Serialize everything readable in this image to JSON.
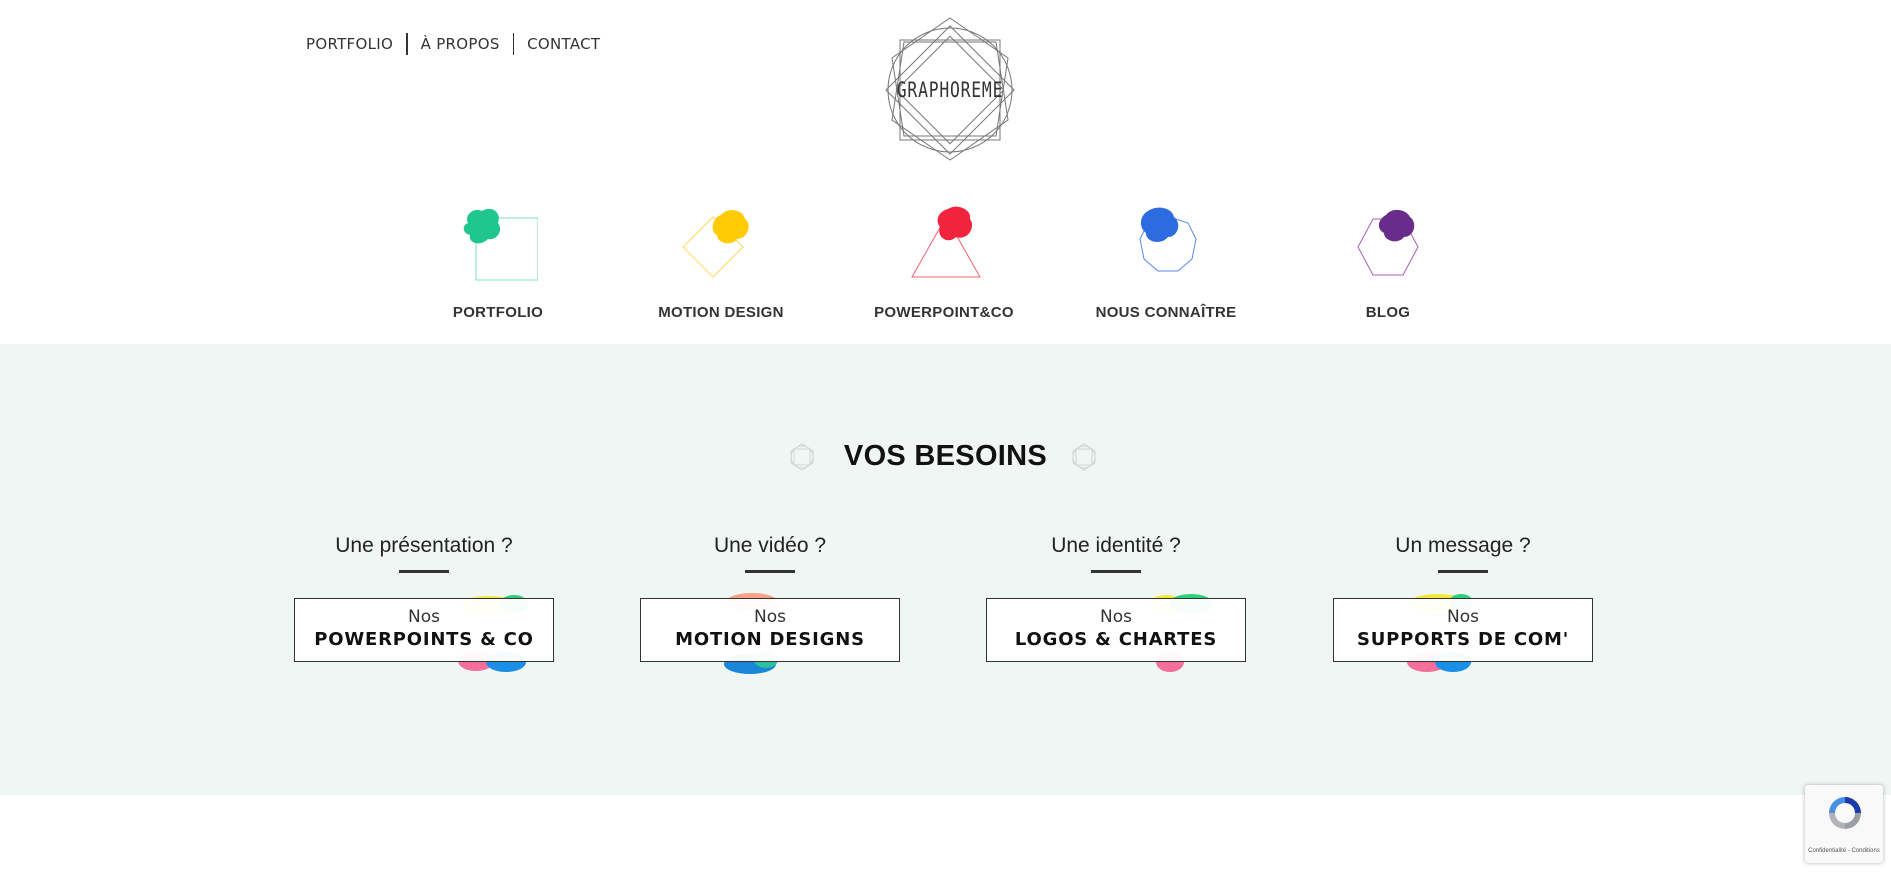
{
  "header": {
    "nav": [
      "PORTFOLIO",
      "À PROPOS",
      "CONTACT"
    ],
    "logo_text": "GRAPHOREME"
  },
  "categories": [
    {
      "label": "PORTFOLIO",
      "icon": "square-green-splash-icon",
      "color": "#1fc78f"
    },
    {
      "label": "MOTION DESIGN",
      "icon": "diamond-yellow-splash-icon",
      "color": "#ffcb05"
    },
    {
      "label": "POWERPOINT&CO",
      "icon": "triangle-red-splash-icon",
      "color": "#f0243c"
    },
    {
      "label": "NOUS CONNAÎTRE",
      "icon": "circle-blue-splash-icon",
      "color": "#2d6be0"
    },
    {
      "label": "BLOG",
      "icon": "hexagon-purple-splash-icon",
      "color": "#6a2c8a"
    }
  ],
  "needs": {
    "title": "VOS BESOINS",
    "items": [
      {
        "question": "Une présentation ?",
        "small": "Nos",
        "big": "POWERPOINTS & CO"
      },
      {
        "question": "Une vidéo ?",
        "small": "Nos",
        "big": "MOTION DESIGNS"
      },
      {
        "question": "Une identité ?",
        "small": "Nos",
        "big": "LOGOS & CHARTES"
      },
      {
        "question": "Un message ?",
        "small": "Nos",
        "big": "SUPPORTS DE COM'"
      }
    ]
  },
  "recaptcha": {
    "links": "Confidentialité - Conditions"
  },
  "colors": {
    "section_background": "#eff6f3",
    "text_dark": "#222222"
  }
}
